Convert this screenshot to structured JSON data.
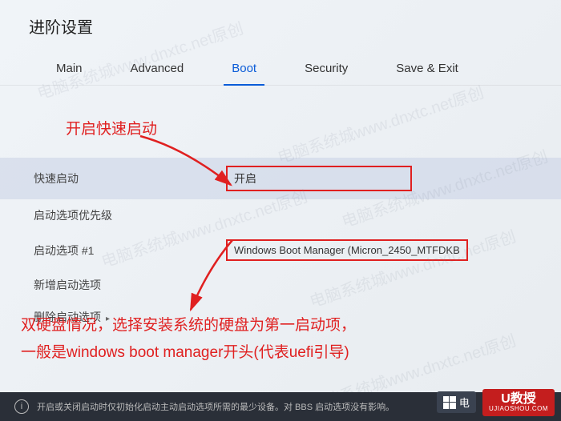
{
  "header": {
    "title": "进阶设置"
  },
  "tabs": [
    {
      "label": "Main",
      "active": false
    },
    {
      "label": "Advanced",
      "active": false
    },
    {
      "label": "Boot",
      "active": true
    },
    {
      "label": "Security",
      "active": false
    },
    {
      "label": "Save & Exit",
      "active": false
    }
  ],
  "annotations": {
    "fast_boot_hint": "开启快速启动",
    "dual_disk_hint_line1": "双硬盘情况，选择安装系统的硬盘为第一启动项，",
    "dual_disk_hint_line2": "一般是windows boot manager开头(代表uefi引导)"
  },
  "settings": {
    "fast_boot": {
      "label": "快速启动",
      "value": "开启"
    },
    "boot_option_priority": {
      "label": "启动选项优先级"
    },
    "boot_option_1": {
      "label": "启动选项 #1",
      "value": "Windows Boot Manager (Micron_2450_MTFDKB"
    },
    "add_boot_option": {
      "label": "新增启动选项"
    },
    "delete_boot_option": {
      "label": "删除启动选项"
    }
  },
  "footer": {
    "help_text": "开启或关闭启动时仅初始化启动主动启动选项所需的最少设备。对 BBS 启动选项没有影响。"
  },
  "watermark": "电脑系统城www.dnxtc.net原创",
  "brands": {
    "left": "电",
    "right_label": "U教授",
    "right_sub": "UJIAOSHOU.COM"
  }
}
